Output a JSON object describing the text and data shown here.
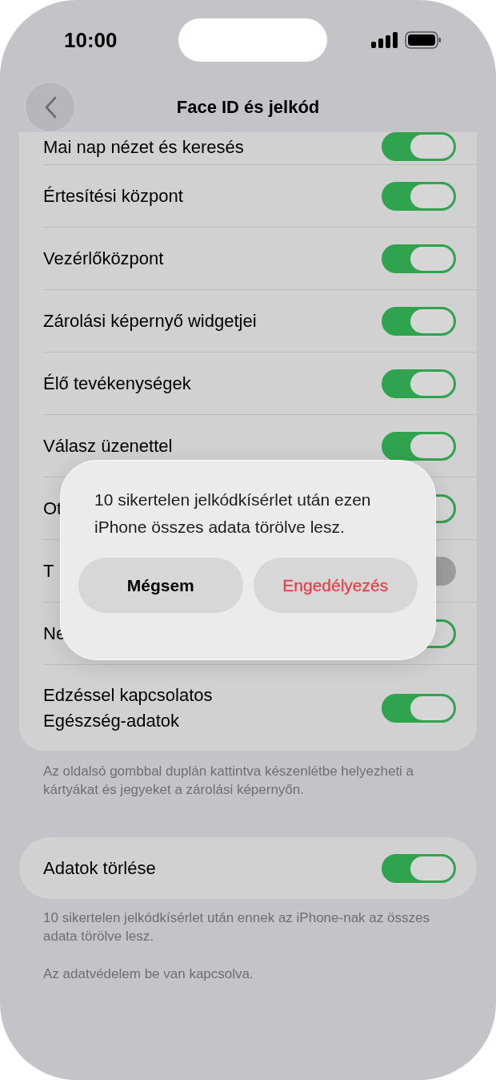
{
  "status_bar": {
    "time": "10:00"
  },
  "nav": {
    "title": "Face ID és jelkód"
  },
  "settings": [
    {
      "label": "Mai nap nézet és keresés",
      "on": true
    },
    {
      "label": "Értesítési központ",
      "on": true
    },
    {
      "label": "Vezérlőközpont",
      "on": true
    },
    {
      "label": "Zárolási képernyő widgetjei",
      "on": true
    },
    {
      "label": "Élő tevékenységek",
      "on": true
    },
    {
      "label": "Válasz üzenettel",
      "on": true
    },
    {
      "label": "Ot",
      "on": true
    },
    {
      "label": "T",
      "on": false
    },
    {
      "label": "Ne",
      "on": true
    },
    {
      "label": "Edzéssel kapcsolatos\nEgészség-adatok",
      "on": true
    }
  ],
  "settings_note": "Az oldalsó gombbal duplán kattintva készenlétbe helyezheti a kártyákat és jegyeket a zárolási képernyőn.",
  "erase": {
    "label": "Adatok törlése",
    "on": true
  },
  "erase_notes": [
    "10 sikertelen jelkódkísérlet után ennek az iPhone-nak az összes adata törölve lesz.",
    "Az adatvédelem be van kapcsolva."
  ],
  "dialog": {
    "message": "10 sikertelen jelkódkísérlet után ezen iPhone összes adata törölve lesz.",
    "buttons": [
      {
        "label": "Mégsem",
        "kind": "cancel"
      },
      {
        "label": "Engedélyezés",
        "kind": "destructive"
      }
    ]
  }
}
